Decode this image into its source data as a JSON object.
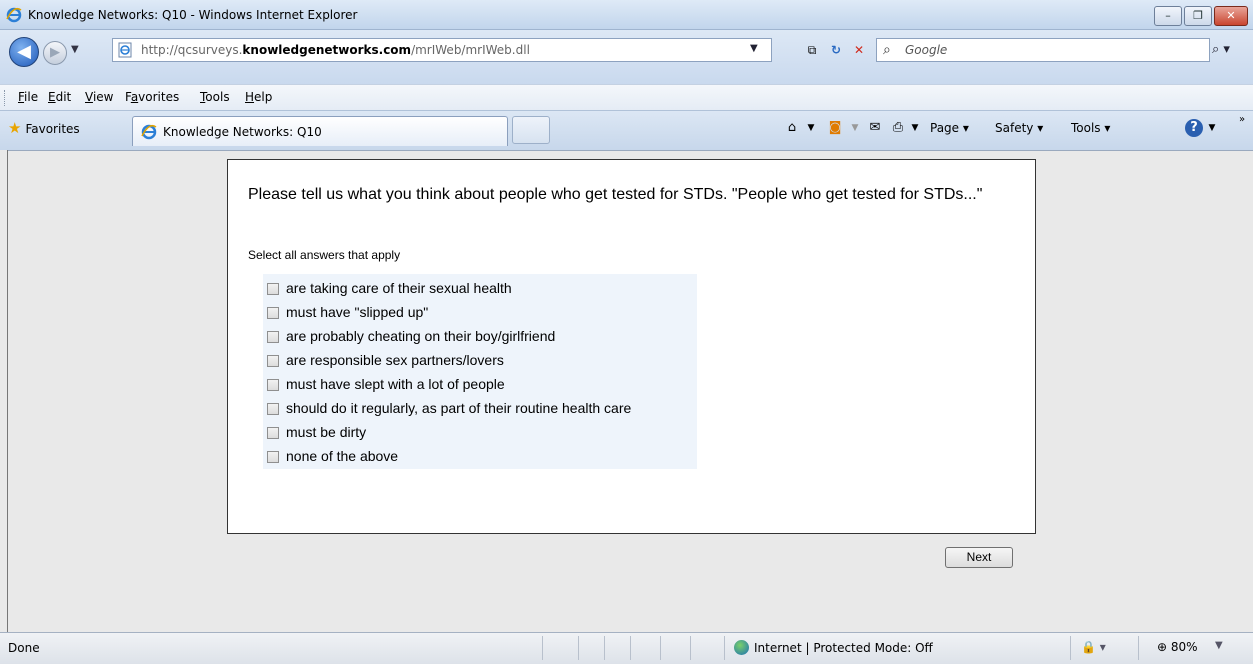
{
  "window": {
    "title": "Knowledge Networks: Q10 - Windows Internet Explorer"
  },
  "address_bar": {
    "url_prefix": "http://qcsurveys.",
    "url_domain": "knowledgenetworks.com",
    "url_path": "/mrIWeb/mrIWeb.dll",
    "search_placeholder": "Google"
  },
  "menu": {
    "items": [
      {
        "first": "F",
        "rest": "ile"
      },
      {
        "first": "E",
        "rest": "dit"
      },
      {
        "first": "V",
        "rest": "iew"
      },
      {
        "first": "a",
        "pre": "F",
        "rest": "vorites"
      },
      {
        "first": "T",
        "rest": "ools"
      },
      {
        "first": "H",
        "rest": "elp"
      }
    ]
  },
  "favorites_bar": {
    "favorites_label": "Favorites",
    "tab_label": "Knowledge Networks: Q10",
    "page_label": "Page",
    "safety_label": "Safety",
    "tools_label": "Tools"
  },
  "survey": {
    "question": "Please tell us what you think about people who get tested for STDs. \"People who get tested for STDs...\"",
    "instruction": "Select all answers that apply",
    "options": [
      {
        "label": "are taking care of their sexual health",
        "checked": false
      },
      {
        "label": "must have \"slipped up\"",
        "checked": false
      },
      {
        "label": "are probably cheating on their boy/girlfriend",
        "checked": false
      },
      {
        "label": "are responsible sex partners/lovers",
        "checked": false
      },
      {
        "label": "must have slept with a lot of people",
        "checked": false
      },
      {
        "label": "should do it regularly, as part of their routine health care",
        "checked": false
      },
      {
        "label": "must be dirty",
        "checked": false
      },
      {
        "label": "none of the above",
        "checked": false
      }
    ],
    "next_label": "Next"
  },
  "status_bar": {
    "status": "Done",
    "zone": "Internet | Protected Mode: Off",
    "zoom": "80%"
  },
  "colors": {
    "option_background": "#eef4fb",
    "titlebar": "#c2d5ec"
  }
}
